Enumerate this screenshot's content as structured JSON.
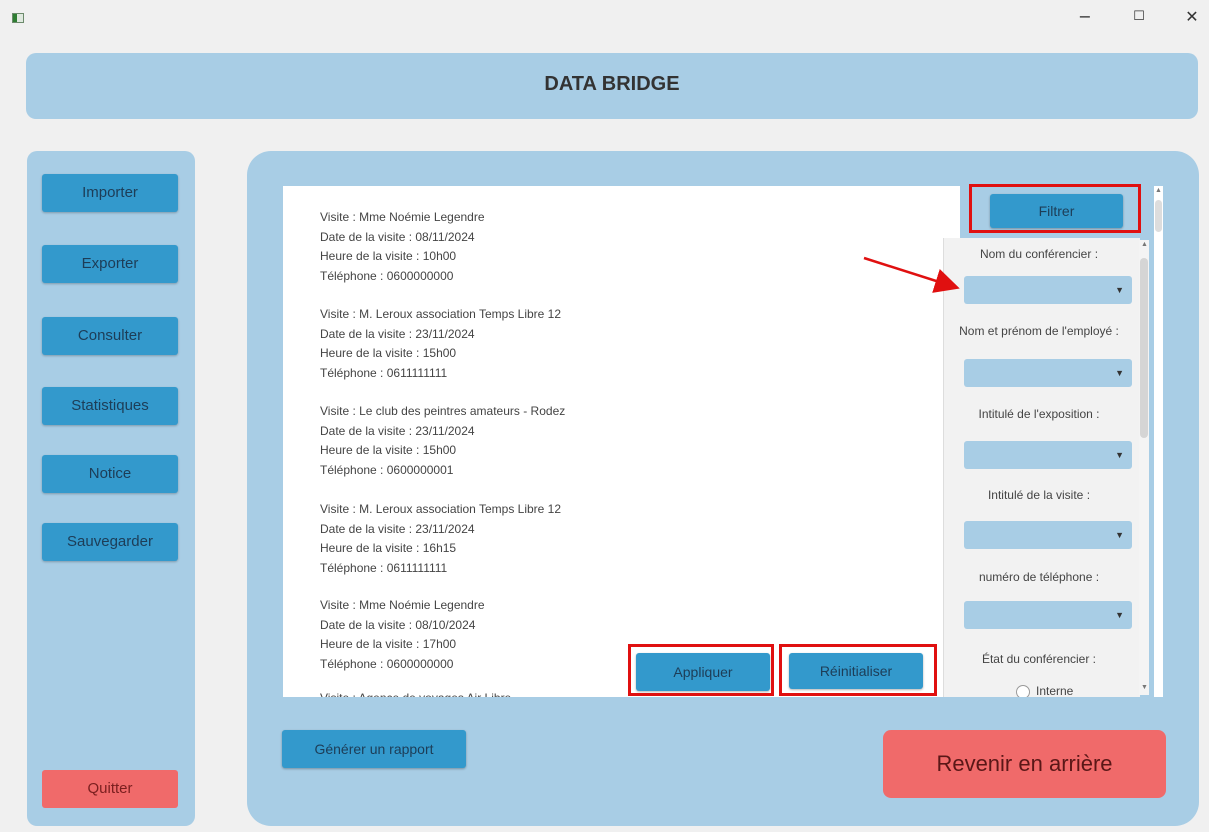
{
  "window": {
    "controls": {
      "minimize": "−",
      "maximize": "☐",
      "close": "✕"
    }
  },
  "app": {
    "title": "DATA BRIDGE"
  },
  "sidebar": {
    "items": [
      {
        "label": "Importer"
      },
      {
        "label": "Exporter"
      },
      {
        "label": "Consulter"
      },
      {
        "label": "Statistiques"
      },
      {
        "label": "Notice"
      },
      {
        "label": "Sauvegarder"
      }
    ],
    "quit_label": "Quitter"
  },
  "results": {
    "visits": [
      {
        "visite": "Visite : Mme Noémie Legendre",
        "date": "Date de la visite : 08/11/2024",
        "heure": "Heure de la visite : 10h00",
        "telephone": "Téléphone : 0600000000"
      },
      {
        "visite": "Visite : M. Leroux association Temps Libre 12",
        "date": "Date de la visite : 23/11/2024",
        "heure": "Heure de la visite : 15h00",
        "telephone": "Téléphone : 0611111111"
      },
      {
        "visite": "Visite : Le club des peintres amateurs - Rodez",
        "date": "Date de la visite : 23/11/2024",
        "heure": "Heure de la visite : 15h00",
        "telephone": "Téléphone : 0600000001"
      },
      {
        "visite": "Visite : M. Leroux association Temps Libre 12",
        "date": "Date de la visite : 23/11/2024",
        "heure": "Heure de la visite : 16h15",
        "telephone": "Téléphone : 0611111111"
      },
      {
        "visite": "Visite : Mme Noémie Legendre",
        "date": "Date de la visite : 08/10/2024",
        "heure": "Heure de la visite : 17h00",
        "telephone": "Téléphone : 0600000000"
      },
      {
        "visite": "Visite : Agence de voyages Air Libre",
        "date": "",
        "heure": "",
        "telephone": ""
      }
    ]
  },
  "filter": {
    "button_label": "Filtrer",
    "fields": [
      {
        "label": "Nom du conférencier :",
        "value": ""
      },
      {
        "label": "Nom et prénom de l'employé :",
        "value": ""
      },
      {
        "label": "Intitulé de l'exposition :",
        "value": ""
      },
      {
        "label": "Intitulé de la visite :",
        "value": ""
      },
      {
        "label": "numéro de téléphone :",
        "value": ""
      }
    ],
    "state_label": "État du conférencier :",
    "radio_interne": "Interne",
    "apply_label": "Appliquer",
    "reset_label": "Réinitialiser"
  },
  "footer": {
    "report_label": "Générer un rapport",
    "back_label": "Revenir en arrière"
  },
  "colors": {
    "panel": "#a8cde5",
    "button": "#3399cc",
    "danger": "#f06a6a",
    "highlight": "#e01010"
  }
}
